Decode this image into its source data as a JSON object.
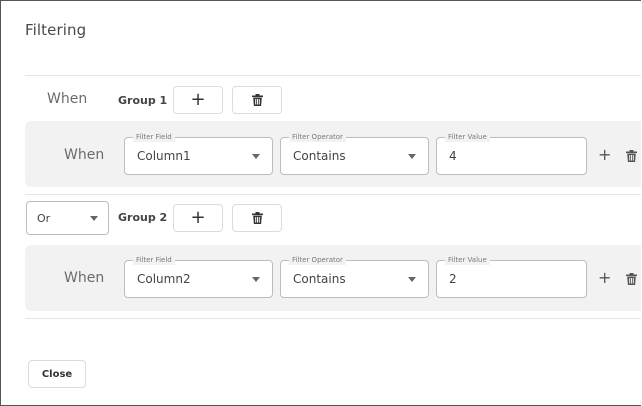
{
  "dialog": {
    "title": "Filtering",
    "close_label": "Close"
  },
  "groups": [
    {
      "prefix_label": "When",
      "name": "Group 1",
      "rule": {
        "when_label": "When",
        "field": {
          "legend": "Filter Field",
          "value": "Column1"
        },
        "operator": {
          "legend": "Filter Operator",
          "value": "Contains"
        },
        "value": {
          "legend": "Filter Value",
          "value": "4"
        }
      }
    },
    {
      "connector": "Or",
      "name": "Group 2",
      "rule": {
        "when_label": "When",
        "field": {
          "legend": "Filter Field",
          "value": "Column2"
        },
        "operator": {
          "legend": "Filter Operator",
          "value": "Contains"
        },
        "value": {
          "legend": "Filter Value",
          "value": "2"
        }
      }
    }
  ],
  "icons": {
    "add": "plus-icon",
    "delete": "trash-icon",
    "dropdown": "caret-down-icon"
  },
  "glyphs": {
    "plus": "+"
  }
}
